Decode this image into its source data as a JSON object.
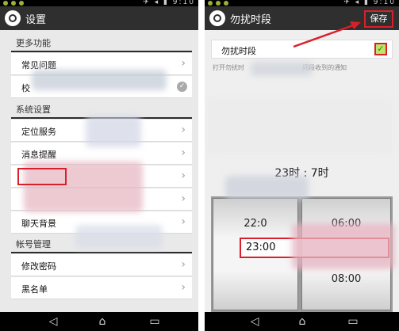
{
  "left": {
    "status_right": "✈ ◂ ▮ 9:10",
    "title": "设置",
    "sections": [
      {
        "header": "更多功能",
        "rows": [
          "常见问题",
          "校"
        ]
      },
      {
        "header": "系统设置",
        "rows": [
          "定位服务",
          "消息提醒",
          "",
          "",
          "聊天背景"
        ]
      },
      {
        "header": "帐号管理",
        "rows": [
          "修改密码",
          "黑名单"
        ]
      }
    ],
    "nav": {
      "back": "◁",
      "home": "⌂",
      "recents": "▭"
    }
  },
  "right": {
    "status_right": "✈ ◂ ▮ 9:10",
    "title": "勿扰时段",
    "save_label": "保存",
    "toggle_label": "勿扰时段",
    "hint_left": "打开勿扰时",
    "hint_right": "间段收到的通知",
    "time_display": "23时 : 7时",
    "picker": {
      "left_top": "22:0",
      "right_top": "06:00",
      "selected": "23:00",
      "bottom": "08:00"
    },
    "nav": {
      "back": "◁",
      "home": "⌂",
      "recents": "▭"
    }
  },
  "colors": {
    "actionbar": "#2f2f2f",
    "highlight": "#d8202a",
    "checkbox": "#bde66a"
  },
  "icons": [
    "app-logo-icon",
    "chevron-right-icon",
    "check-circle-icon",
    "back-icon",
    "home-icon",
    "recents-icon",
    "checkbox-checked-icon",
    "red-arrow-icon"
  ]
}
